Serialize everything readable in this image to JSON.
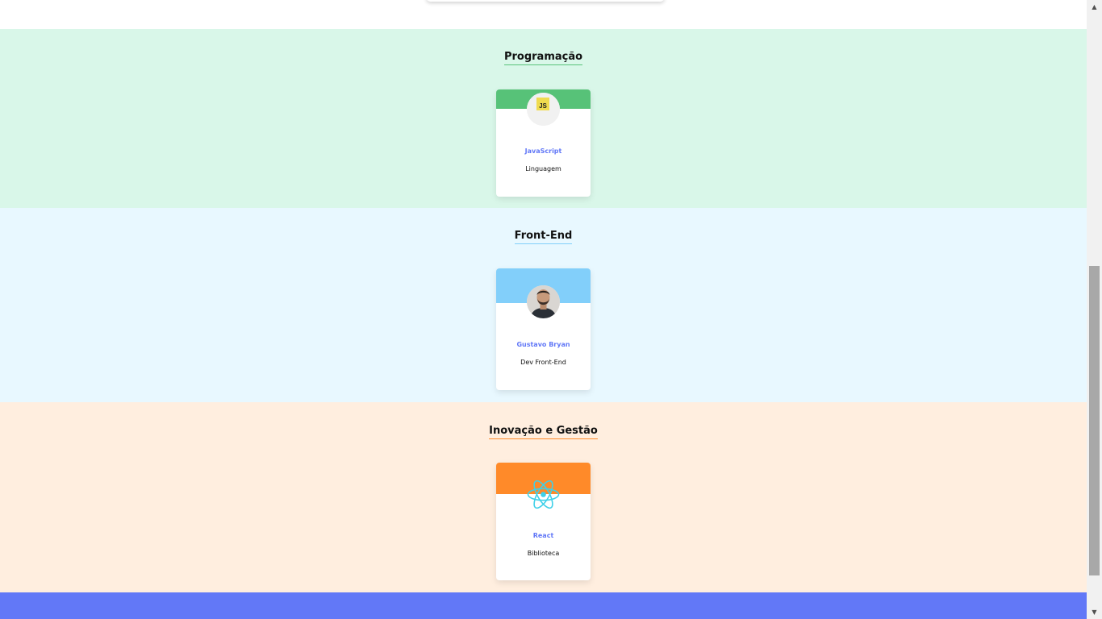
{
  "colors": {
    "page_bg": "#ffffff",
    "link_text": "#6278f7",
    "footer_bg": "#6278f7",
    "scrollbar_track": "#f1f1f1",
    "scrollbar_thumb": "#a8a8a8"
  },
  "sections": [
    {
      "title": "Programação",
      "bg_color": "#d9f7e9",
      "accent_color": "#57c278",
      "card": {
        "name": "JavaScript",
        "role": "Linguagem",
        "avatar_icon": "javascript-logo-icon"
      }
    },
    {
      "title": "Front-End",
      "bg_color": "#e8f8ff",
      "accent_color": "#82cffa",
      "card": {
        "name": "Gustavo Bryan",
        "role": "Dev Front-End",
        "avatar_icon": "person-photo"
      }
    },
    {
      "title": "Inovação e Gestão",
      "bg_color": "#ffeedf",
      "accent_color": "#ff8a29",
      "card": {
        "name": "React",
        "role": "Biblioteca",
        "avatar_icon": "react-logo-icon"
      }
    }
  ],
  "javascript_logo_text": "JS",
  "scrollbar": {
    "up_icon": "triangle-up-icon",
    "down_icon": "triangle-down-icon"
  }
}
